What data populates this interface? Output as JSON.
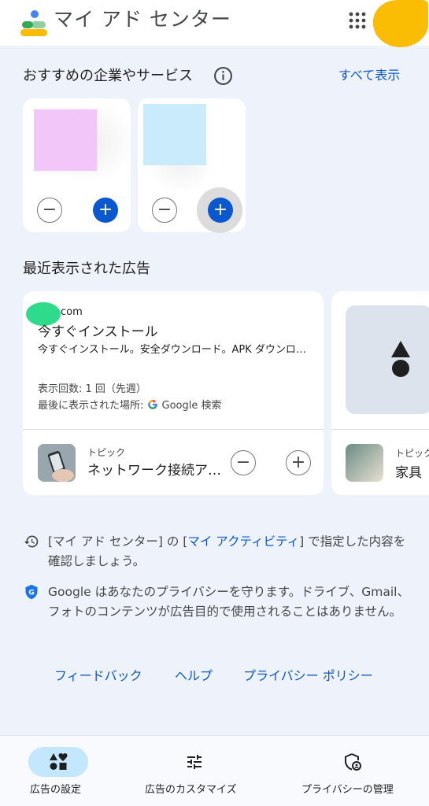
{
  "header": {
    "title": "マイ アド センター",
    "apps_icon": "apps-grid-icon",
    "avatar_color": "#fbbc04"
  },
  "recommended": {
    "title": "おすすめの企業やサービス",
    "see_all": "すべて表示",
    "cards": [
      {
        "image_color": "#f2c6f8",
        "remove_icon": "minus-icon",
        "add_icon": "plus-icon"
      },
      {
        "image_color": "#c9ebfb",
        "remove_icon": "minus-icon",
        "add_icon": "plus-icon"
      }
    ]
  },
  "recent_ads": {
    "title": "最近表示された広告",
    "ads": [
      {
        "domain": "com",
        "headline": "今すぐインストール",
        "description": "今すぐインストール。安全ダウンロード。APK ダウンロード",
        "impressions": "表示回数: 1 回（先週）",
        "last_seen": "最後に表示された場所: ",
        "last_seen_place": "Google 検索",
        "topic_label": "トピック",
        "topic_name": "ネットワーク接続ア…"
      },
      {
        "topic_label": "トピック",
        "topic_name": "家具"
      }
    ]
  },
  "info": {
    "activity_pre": "[マイ アド センター] の [",
    "activity_link": "マイ アクティビティ",
    "activity_post": "] で指定した内容を確認しましょう。",
    "privacy": "Google はあなたのプライバシーを守ります。ドライブ、Gmail、フォトのコンテンツが広告目的で使用されることはありません。"
  },
  "footer": {
    "feedback": "フィードバック",
    "help": "ヘルプ",
    "privacy_policy": "プライバシー ポリシー"
  },
  "bottom_nav": [
    {
      "label": "広告の設定",
      "icon": "ad-settings-icon",
      "active": true
    },
    {
      "label": "広告のカスタマイズ",
      "icon": "tune-icon",
      "active": false
    },
    {
      "label": "プライバシーの管理",
      "icon": "privacy-shield-icon",
      "active": false
    }
  ],
  "colors": {
    "accent": "#0b57d0",
    "background": "#eef2fb",
    "nav_active": "#c2e7ff"
  }
}
